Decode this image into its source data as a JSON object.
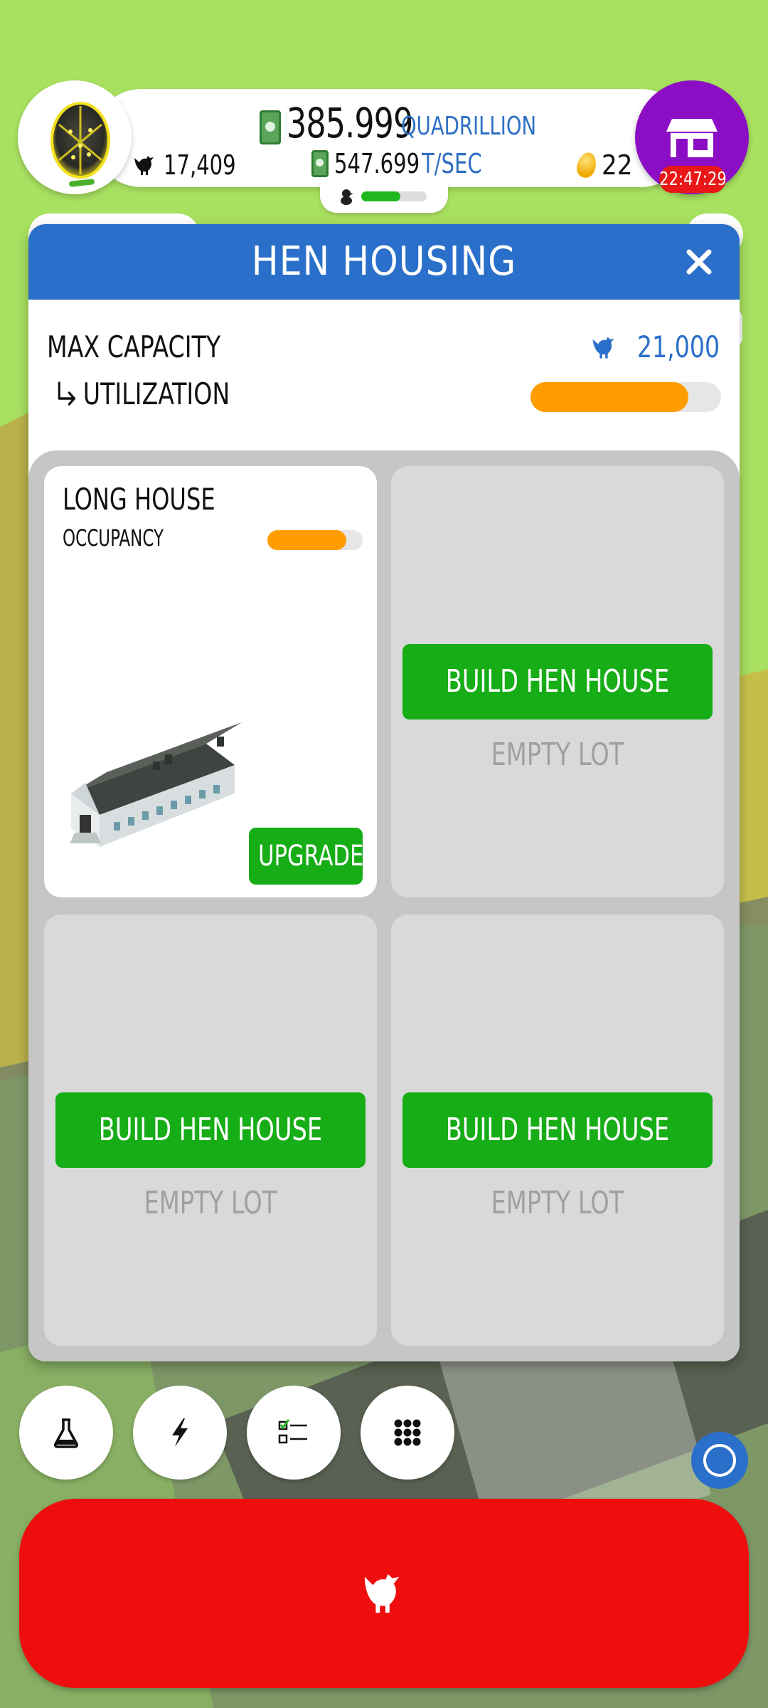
{
  "topbar": {
    "money_amount": "385.999",
    "money_unit": "QUADRILLION",
    "earning_rate": "547.699",
    "earning_unit": "T/SEC",
    "chicken_count": "17,409",
    "golden_eggs": "22",
    "shop_timer": "22:47:29",
    "hatchery_progress": 0.6
  },
  "panel": {
    "title": "HEN HOUSING",
    "max_capacity_label": "MAX CAPACITY",
    "max_capacity_value": "21,000",
    "utilization_label": "UTILIZATION",
    "utilization": 0.83
  },
  "lots": [
    {
      "built": true,
      "name": "LONG HOUSE",
      "occupancy_label": "OCCUPANCY",
      "occupancy": 0.83,
      "upgrade_label": "UPGRADE"
    },
    {
      "built": false,
      "build_label": "BUILD HEN HOUSE",
      "empty_label": "EMPTY LOT"
    },
    {
      "built": false,
      "build_label": "BUILD HEN HOUSE",
      "empty_label": "EMPTY LOT"
    },
    {
      "built": false,
      "build_label": "BUILD HEN HOUSE",
      "empty_label": "EMPTY LOT"
    }
  ],
  "bottom_buttons": [
    {
      "icon": "flask-icon"
    },
    {
      "icon": "lightning-icon"
    },
    {
      "icon": "checklist-icon"
    },
    {
      "icon": "grid-menu-icon"
    }
  ],
  "colors": {
    "header_blue": "#2a6fc9",
    "build_green": "#17ad17",
    "bar_orange": "#ff9d00",
    "hatch_red": "#ee0e0e",
    "shop_purple": "#8b0ec4"
  }
}
